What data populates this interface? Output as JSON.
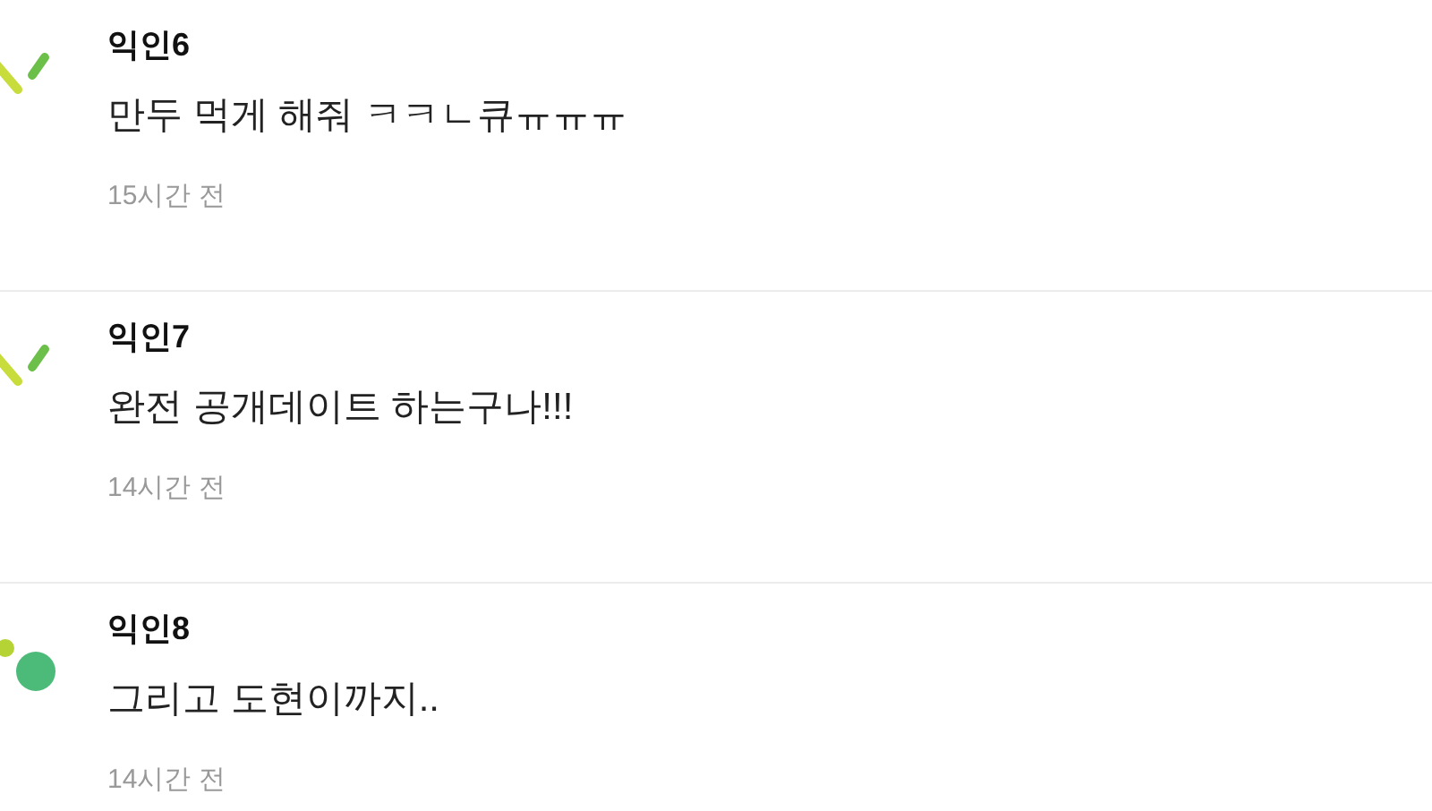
{
  "comments": [
    {
      "author": "익인6",
      "text": "만두 먹게 해줘 ㅋㅋㄴ큐ㅠㅠㅠ",
      "time": "15시간 전",
      "kind": "strokes"
    },
    {
      "author": "익인7",
      "text": "완전 공개데이트 하는구나!!!",
      "time": "14시간 전",
      "kind": "strokes"
    },
    {
      "author": "익인8",
      "text": "그리고 도현이까지..",
      "time": "14시간 전",
      "kind": "dots"
    }
  ]
}
